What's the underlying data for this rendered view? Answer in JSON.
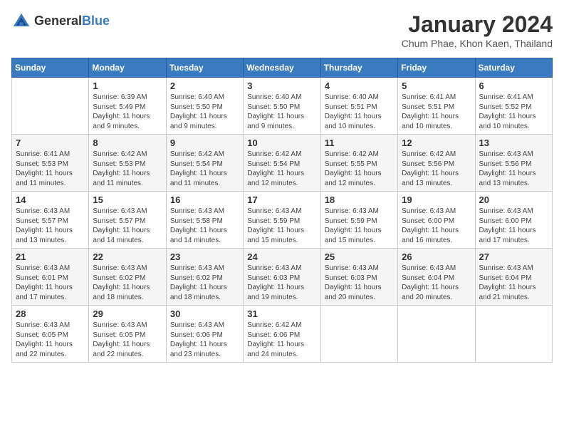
{
  "header": {
    "logo_general": "General",
    "logo_blue": "Blue",
    "title": "January 2024",
    "subtitle": "Chum Phae, Khon Kaen, Thailand"
  },
  "days_of_week": [
    "Sunday",
    "Monday",
    "Tuesday",
    "Wednesday",
    "Thursday",
    "Friday",
    "Saturday"
  ],
  "weeks": [
    [
      {
        "day": "",
        "sunrise": "",
        "sunset": "",
        "daylight": ""
      },
      {
        "day": "1",
        "sunrise": "Sunrise: 6:39 AM",
        "sunset": "Sunset: 5:49 PM",
        "daylight": "Daylight: 11 hours and 9 minutes."
      },
      {
        "day": "2",
        "sunrise": "Sunrise: 6:40 AM",
        "sunset": "Sunset: 5:50 PM",
        "daylight": "Daylight: 11 hours and 9 minutes."
      },
      {
        "day": "3",
        "sunrise": "Sunrise: 6:40 AM",
        "sunset": "Sunset: 5:50 PM",
        "daylight": "Daylight: 11 hours and 9 minutes."
      },
      {
        "day": "4",
        "sunrise": "Sunrise: 6:40 AM",
        "sunset": "Sunset: 5:51 PM",
        "daylight": "Daylight: 11 hours and 10 minutes."
      },
      {
        "day": "5",
        "sunrise": "Sunrise: 6:41 AM",
        "sunset": "Sunset: 5:51 PM",
        "daylight": "Daylight: 11 hours and 10 minutes."
      },
      {
        "day": "6",
        "sunrise": "Sunrise: 6:41 AM",
        "sunset": "Sunset: 5:52 PM",
        "daylight": "Daylight: 11 hours and 10 minutes."
      }
    ],
    [
      {
        "day": "7",
        "sunrise": "Sunrise: 6:41 AM",
        "sunset": "Sunset: 5:53 PM",
        "daylight": "Daylight: 11 hours and 11 minutes."
      },
      {
        "day": "8",
        "sunrise": "Sunrise: 6:42 AM",
        "sunset": "Sunset: 5:53 PM",
        "daylight": "Daylight: 11 hours and 11 minutes."
      },
      {
        "day": "9",
        "sunrise": "Sunrise: 6:42 AM",
        "sunset": "Sunset: 5:54 PM",
        "daylight": "Daylight: 11 hours and 11 minutes."
      },
      {
        "day": "10",
        "sunrise": "Sunrise: 6:42 AM",
        "sunset": "Sunset: 5:54 PM",
        "daylight": "Daylight: 11 hours and 12 minutes."
      },
      {
        "day": "11",
        "sunrise": "Sunrise: 6:42 AM",
        "sunset": "Sunset: 5:55 PM",
        "daylight": "Daylight: 11 hours and 12 minutes."
      },
      {
        "day": "12",
        "sunrise": "Sunrise: 6:42 AM",
        "sunset": "Sunset: 5:56 PM",
        "daylight": "Daylight: 11 hours and 13 minutes."
      },
      {
        "day": "13",
        "sunrise": "Sunrise: 6:43 AM",
        "sunset": "Sunset: 5:56 PM",
        "daylight": "Daylight: 11 hours and 13 minutes."
      }
    ],
    [
      {
        "day": "14",
        "sunrise": "Sunrise: 6:43 AM",
        "sunset": "Sunset: 5:57 PM",
        "daylight": "Daylight: 11 hours and 13 minutes."
      },
      {
        "day": "15",
        "sunrise": "Sunrise: 6:43 AM",
        "sunset": "Sunset: 5:57 PM",
        "daylight": "Daylight: 11 hours and 14 minutes."
      },
      {
        "day": "16",
        "sunrise": "Sunrise: 6:43 AM",
        "sunset": "Sunset: 5:58 PM",
        "daylight": "Daylight: 11 hours and 14 minutes."
      },
      {
        "day": "17",
        "sunrise": "Sunrise: 6:43 AM",
        "sunset": "Sunset: 5:59 PM",
        "daylight": "Daylight: 11 hours and 15 minutes."
      },
      {
        "day": "18",
        "sunrise": "Sunrise: 6:43 AM",
        "sunset": "Sunset: 5:59 PM",
        "daylight": "Daylight: 11 hours and 15 minutes."
      },
      {
        "day": "19",
        "sunrise": "Sunrise: 6:43 AM",
        "sunset": "Sunset: 6:00 PM",
        "daylight": "Daylight: 11 hours and 16 minutes."
      },
      {
        "day": "20",
        "sunrise": "Sunrise: 6:43 AM",
        "sunset": "Sunset: 6:00 PM",
        "daylight": "Daylight: 11 hours and 17 minutes."
      }
    ],
    [
      {
        "day": "21",
        "sunrise": "Sunrise: 6:43 AM",
        "sunset": "Sunset: 6:01 PM",
        "daylight": "Daylight: 11 hours and 17 minutes."
      },
      {
        "day": "22",
        "sunrise": "Sunrise: 6:43 AM",
        "sunset": "Sunset: 6:02 PM",
        "daylight": "Daylight: 11 hours and 18 minutes."
      },
      {
        "day": "23",
        "sunrise": "Sunrise: 6:43 AM",
        "sunset": "Sunset: 6:02 PM",
        "daylight": "Daylight: 11 hours and 18 minutes."
      },
      {
        "day": "24",
        "sunrise": "Sunrise: 6:43 AM",
        "sunset": "Sunset: 6:03 PM",
        "daylight": "Daylight: 11 hours and 19 minutes."
      },
      {
        "day": "25",
        "sunrise": "Sunrise: 6:43 AM",
        "sunset": "Sunset: 6:03 PM",
        "daylight": "Daylight: 11 hours and 20 minutes."
      },
      {
        "day": "26",
        "sunrise": "Sunrise: 6:43 AM",
        "sunset": "Sunset: 6:04 PM",
        "daylight": "Daylight: 11 hours and 20 minutes."
      },
      {
        "day": "27",
        "sunrise": "Sunrise: 6:43 AM",
        "sunset": "Sunset: 6:04 PM",
        "daylight": "Daylight: 11 hours and 21 minutes."
      }
    ],
    [
      {
        "day": "28",
        "sunrise": "Sunrise: 6:43 AM",
        "sunset": "Sunset: 6:05 PM",
        "daylight": "Daylight: 11 hours and 22 minutes."
      },
      {
        "day": "29",
        "sunrise": "Sunrise: 6:43 AM",
        "sunset": "Sunset: 6:05 PM",
        "daylight": "Daylight: 11 hours and 22 minutes."
      },
      {
        "day": "30",
        "sunrise": "Sunrise: 6:43 AM",
        "sunset": "Sunset: 6:06 PM",
        "daylight": "Daylight: 11 hours and 23 minutes."
      },
      {
        "day": "31",
        "sunrise": "Sunrise: 6:42 AM",
        "sunset": "Sunset: 6:06 PM",
        "daylight": "Daylight: 11 hours and 24 minutes."
      },
      {
        "day": "",
        "sunrise": "",
        "sunset": "",
        "daylight": ""
      },
      {
        "day": "",
        "sunrise": "",
        "sunset": "",
        "daylight": ""
      },
      {
        "day": "",
        "sunrise": "",
        "sunset": "",
        "daylight": ""
      }
    ]
  ]
}
